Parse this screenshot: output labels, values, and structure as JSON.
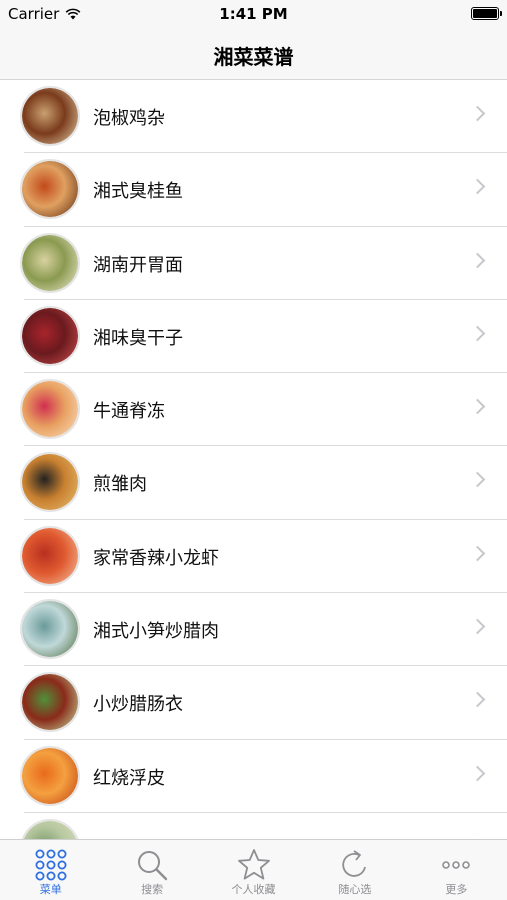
{
  "status_bar": {
    "carrier": "Carrier",
    "time": "1:41 PM"
  },
  "nav": {
    "title": "湘菜菜谱"
  },
  "recipes": [
    {
      "name": "泡椒鸡杂",
      "thumb_colors": [
        "#c9a070",
        "#7a3b1c",
        "#e6d1a8"
      ]
    },
    {
      "name": "湘式臭桂鱼",
      "thumb_colors": [
        "#c24a1a",
        "#e0a060",
        "#5a2a10"
      ]
    },
    {
      "name": "湖南开胃面",
      "thumb_colors": [
        "#d8d2a0",
        "#8a9a50",
        "#f0ead0"
      ]
    },
    {
      "name": "湘味臭干子",
      "thumb_colors": [
        "#a8242c",
        "#6a1a1e",
        "#d05050"
      ]
    },
    {
      "name": "牛通脊冻",
      "thumb_colors": [
        "#d03050",
        "#e8a060",
        "#fbe0c0"
      ]
    },
    {
      "name": "煎雏肉",
      "thumb_colors": [
        "#222222",
        "#c88030",
        "#e8c070"
      ]
    },
    {
      "name": "家常香辣小龙虾",
      "thumb_colors": [
        "#b83020",
        "#e05a30",
        "#f4c4a0"
      ]
    },
    {
      "name": "湘式小笋炒腊肉",
      "thumb_colors": [
        "#6a9a9a",
        "#c0d8d8",
        "#4a6a3a"
      ]
    },
    {
      "name": "小炒腊肠衣",
      "thumb_colors": [
        "#50903a",
        "#8a2a1a",
        "#c8e0a0"
      ]
    },
    {
      "name": "红烧浮皮",
      "thumb_colors": [
        "#e86a1a",
        "#f4a040",
        "#c04010"
      ]
    },
    {
      "name": "",
      "thumb_colors": [
        "#7a9a6a",
        "#b8c8a0",
        "#d8e0c0"
      ]
    }
  ],
  "tabs": [
    {
      "label": "菜单",
      "icon": "grid-icon",
      "active": true
    },
    {
      "label": "搜索",
      "icon": "search-icon",
      "active": false
    },
    {
      "label": "个人收藏",
      "icon": "star-icon",
      "active": false
    },
    {
      "label": "随心选",
      "icon": "refresh-icon",
      "active": false
    },
    {
      "label": "更多",
      "icon": "more-icon",
      "active": false
    }
  ],
  "colors": {
    "accent": "#2f6fe0",
    "inactive": "#8e8e93"
  }
}
